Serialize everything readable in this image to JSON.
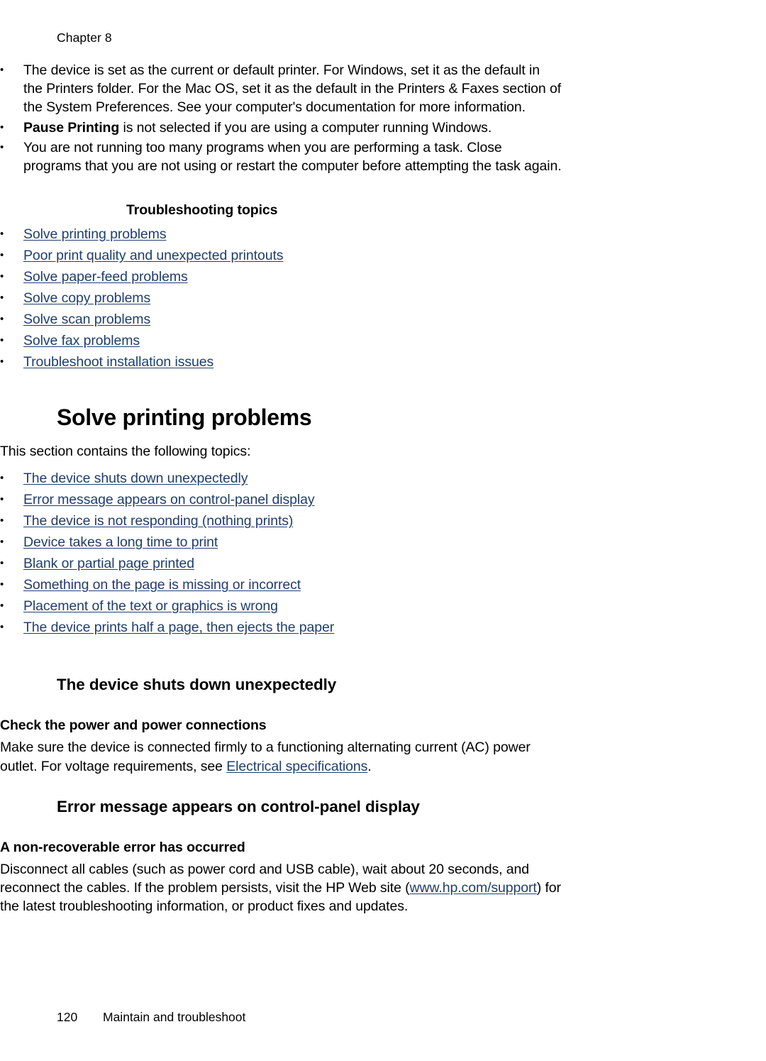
{
  "header": {
    "chapter": "Chapter 8"
  },
  "intro_bullets": [
    {
      "bold_lead": "",
      "text": "The device is set as the current or default printer. For Windows, set it as the default in the Printers folder. For the Mac OS, set it as the default in the Printers & Faxes section of the System Preferences. See your computer's documentation for more information."
    },
    {
      "bold_lead": "Pause Printing",
      "text": " is not selected if you are using a computer running Windows."
    },
    {
      "bold_lead": "",
      "text": "You are not running too many programs when you are performing a task. Close programs that you are not using or restart the computer before attempting the task again."
    }
  ],
  "troubleshooting": {
    "title": "Troubleshooting topics",
    "links": [
      "Solve printing problems",
      "Poor print quality and unexpected printouts",
      "Solve paper-feed problems",
      "Solve copy problems",
      "Solve scan problems",
      "Solve fax problems",
      "Troubleshoot installation issues"
    ]
  },
  "section_printing": {
    "heading": "Solve printing problems",
    "intro": "This section contains the following topics:",
    "links": [
      "The device shuts down unexpectedly",
      "Error message appears on control-panel display",
      "The device is not responding (nothing prints)",
      "Device takes a long time to print",
      "Blank or partial page printed",
      "Something on the page is missing or incorrect",
      "Placement of the text or graphics is wrong",
      "The device prints half a page, then ejects the paper"
    ]
  },
  "section_shutdown": {
    "heading": "The device shuts down unexpectedly",
    "subheading": "Check the power and power connections",
    "body_part1": "Make sure the device is connected firmly to a functioning alternating current (AC) power outlet. For voltage requirements, see ",
    "body_link": "Electrical specifications",
    "body_part2": "."
  },
  "section_error": {
    "heading": "Error message appears on control-panel display",
    "subheading": "A non-recoverable error has occurred",
    "body_part1": "Disconnect all cables (such as power cord and USB cable), wait about 20 seconds, and reconnect the cables. If the problem persists, visit the HP Web site (",
    "body_link": "www.hp.com/support",
    "body_part2": ") for the latest troubleshooting information, or product fixes and updates."
  },
  "footer": {
    "page_number": "120",
    "section_name": "Maintain and troubleshoot"
  },
  "colors": {
    "link": "#1F3E6E",
    "text": "#000000",
    "background": "#FFFFFF"
  }
}
